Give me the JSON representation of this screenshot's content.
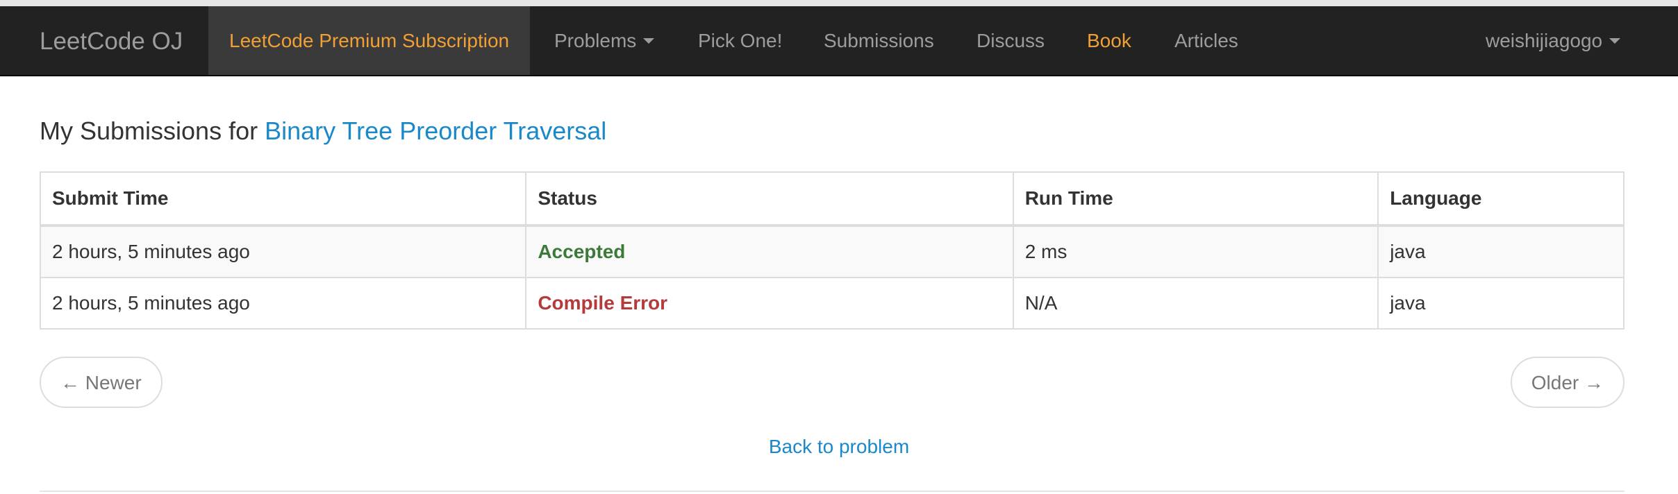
{
  "navbar": {
    "brand": "LeetCode OJ",
    "premium": "LeetCode Premium Subscription",
    "problems": "Problems",
    "pick_one": "Pick One!",
    "submissions": "Submissions",
    "discuss": "Discuss",
    "book": "Book",
    "articles": "Articles",
    "user": "weishijiagogo"
  },
  "page": {
    "title_prefix": "My Submissions for",
    "problem_name": "Binary Tree Preorder Traversal"
  },
  "table": {
    "headers": [
      "Submit Time",
      "Status",
      "Run Time",
      "Language"
    ],
    "rows": [
      {
        "submit_time": "2 hours, 5 minutes ago",
        "status": "Accepted",
        "run_time": "2 ms",
        "language": "java"
      },
      {
        "submit_time": "2 hours, 5 minutes ago",
        "status": "Compile Error",
        "run_time": "N/A",
        "language": "java"
      }
    ]
  },
  "pager": {
    "newer": "← Newer",
    "older": "Older →"
  },
  "back_to_problem": "Back to problem",
  "colors": {
    "accent_link": "#1a88c9",
    "accepted": "#3c7a3a",
    "error": "#b33b3b",
    "nav_highlight": "#f0a035"
  }
}
